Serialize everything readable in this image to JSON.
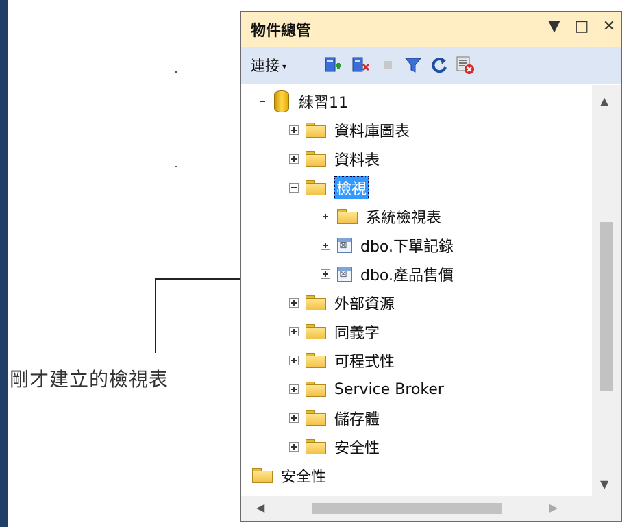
{
  "callout": "剛才建立的檢視表",
  "panel": {
    "title": "物件總管",
    "buttons": [
      "▼",
      "□",
      "✕"
    ],
    "toolbar": {
      "connect_label": "連接",
      "connect_arrow": "▾"
    }
  },
  "tree": [
    {
      "label": "練習11",
      "icon": "database-icon",
      "expander": "minus"
    },
    {
      "label": "資料庫圖表",
      "icon": "folder-icon",
      "expander": "plus"
    },
    {
      "label": "資料表",
      "icon": "folder-icon",
      "expander": "plus"
    },
    {
      "label": "檢視",
      "icon": "folder-icon",
      "expander": "minus",
      "selected": true
    },
    {
      "label": "系統檢視表",
      "icon": "folder-icon",
      "expander": "plus"
    },
    {
      "label": "dbo.下單記錄",
      "icon": "view-icon",
      "expander": "plus"
    },
    {
      "label": "dbo.產品售價",
      "icon": "view-icon",
      "expander": "plus"
    },
    {
      "label": "外部資源",
      "icon": "folder-icon",
      "expander": "plus"
    },
    {
      "label": "同義字",
      "icon": "folder-icon",
      "expander": "plus"
    },
    {
      "label": "可程式性",
      "icon": "folder-icon",
      "expander": "plus"
    },
    {
      "label": "Service Broker",
      "icon": "folder-icon",
      "expander": "plus"
    },
    {
      "label": "儲存體",
      "icon": "folder-icon",
      "expander": "plus"
    },
    {
      "label": "安全性",
      "icon": "folder-icon",
      "expander": "plus"
    },
    {
      "label": "安全性",
      "icon": "folder-icon",
      "expander": "none"
    }
  ],
  "scrollbar": {
    "up": "▲",
    "down": "▼",
    "left": "◀",
    "right": "▶"
  }
}
